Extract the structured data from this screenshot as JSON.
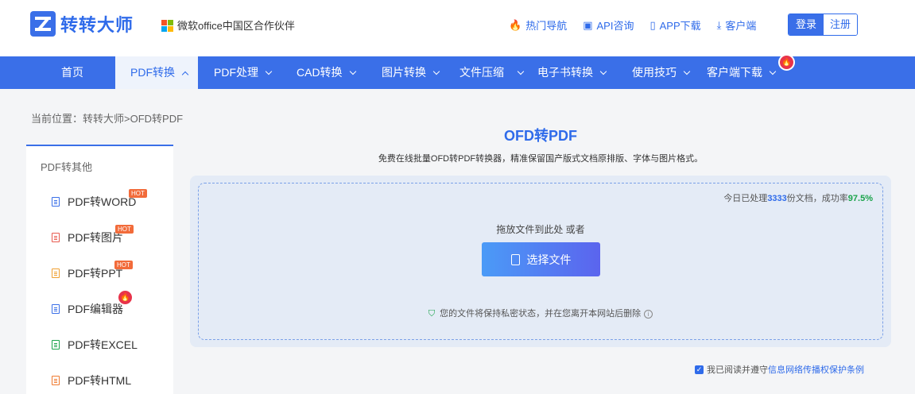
{
  "header": {
    "logo_text": "转转大师",
    "partner_text": "微软office中国区合作伙伴",
    "links": [
      {
        "icon": "fire-icon",
        "label": "热门导航"
      },
      {
        "icon": "chat-icon",
        "label": "API咨询"
      },
      {
        "icon": "phone-icon",
        "label": "APP下载"
      },
      {
        "icon": "download-icon",
        "label": "客户端"
      }
    ],
    "login_label": "登录",
    "register_label": "注册"
  },
  "nav": {
    "items": [
      {
        "label": "首页"
      },
      {
        "label": "PDF转换"
      },
      {
        "label": "PDF处理"
      },
      {
        "label": "CAD转换"
      },
      {
        "label": "图片转换"
      },
      {
        "label": "文件压缩"
      },
      {
        "label": "电子书转换"
      },
      {
        "label": "使用技巧"
      },
      {
        "label": "客户端下载"
      }
    ]
  },
  "breadcrumb": "当前位置：转转大师>OFD转PDF",
  "sidebar": {
    "title": "PDF转其他",
    "items": [
      {
        "label": "PDF转WORD",
        "badge": "HOT",
        "color": "#3a6fe8"
      },
      {
        "label": "PDF转图片",
        "badge": "HOT",
        "color": "#e85a4f"
      },
      {
        "label": "PDF转PPT",
        "badge": "HOT",
        "color": "#f0a030"
      },
      {
        "label": "PDF编辑器",
        "badge": "fire",
        "color": "#3a6fe8"
      },
      {
        "label": "PDF转EXCEL",
        "badge": "",
        "color": "#1aa34a"
      },
      {
        "label": "PDF转HTML",
        "badge": "",
        "color": "#f07a30"
      }
    ]
  },
  "main": {
    "title": "OFD转PDF",
    "subtitle": "免费在线批量OFD转PDF转换器，精准保留国产版式文档原排版、字体与图片格式。",
    "stats_prefix": "今日已处理",
    "stats_count": "3333",
    "stats_mid": "份文档，成功率",
    "stats_rate": "97.5%",
    "drop_hint": "拖放文件到此处 或者",
    "choose_label": "选择文件",
    "privacy_text": "您的文件将保持私密状态，并在您离开本网站后删除",
    "agree_prefix": "我已阅读并遵守",
    "agree_link": "信息网络传播权保护条例"
  },
  "colors": {
    "brand": "#3a6fe8",
    "hot": "#f26b3a",
    "fire": "#e8334a",
    "success": "#1aa34a"
  }
}
